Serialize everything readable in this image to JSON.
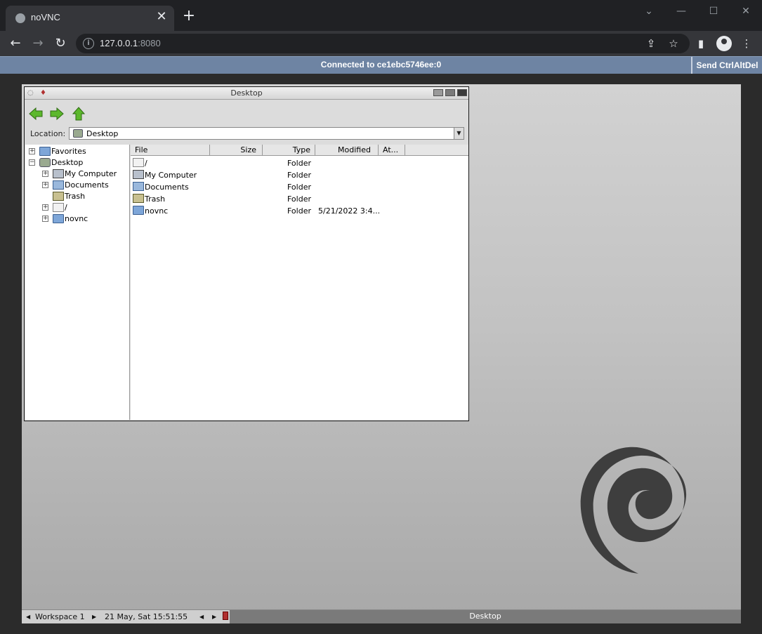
{
  "browser": {
    "tab_title": "noVNC",
    "tab_close": "✕",
    "new_tab": "+",
    "url_host": "127.0.0.1",
    "url_port": ":8080"
  },
  "novnc": {
    "status": "Connected to ce1ebc5746ee:0",
    "send_ctrlaltdel": "Send CtrlAltDel"
  },
  "file_manager": {
    "title": "Desktop",
    "location_label": "Location:",
    "location_value": "Desktop",
    "tree": [
      {
        "label": "Favorites"
      },
      {
        "label": "Desktop"
      },
      {
        "label": "My Computer"
      },
      {
        "label": "Documents"
      },
      {
        "label": "Trash"
      },
      {
        "label": "/"
      },
      {
        "label": "novnc"
      }
    ],
    "columns": [
      "File",
      "Size",
      "Type",
      "Modified",
      "At..."
    ],
    "rows": [
      {
        "name": "/",
        "type": "Folder",
        "modified": ""
      },
      {
        "name": "My Computer",
        "type": "Folder",
        "modified": ""
      },
      {
        "name": "Documents",
        "type": "Folder",
        "modified": ""
      },
      {
        "name": "Trash",
        "type": "Folder",
        "modified": ""
      },
      {
        "name": "novnc",
        "type": "Folder",
        "modified": "5/21/2022 3:4..."
      }
    ]
  },
  "taskbar": {
    "workspace": "Workspace 1",
    "clock": "21 May, Sat 15:51:55",
    "active_task": "Desktop"
  }
}
